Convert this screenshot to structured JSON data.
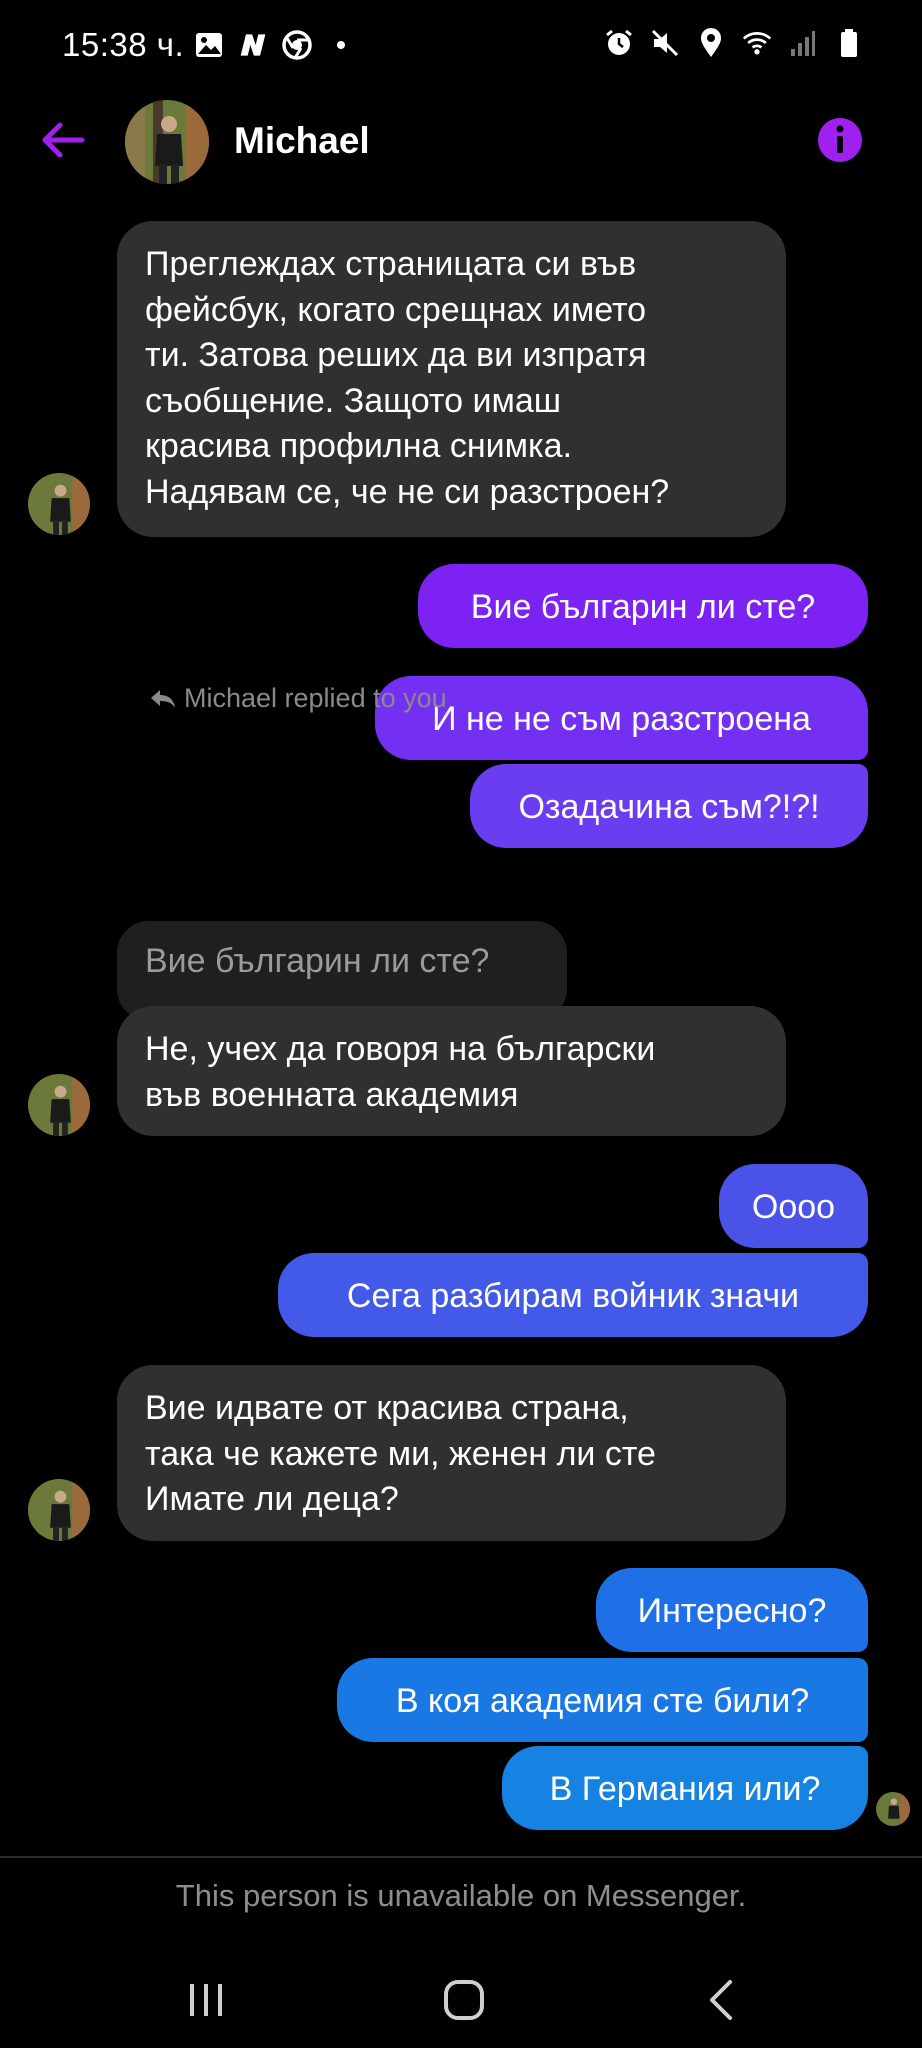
{
  "status_bar": {
    "time": "15:38 ч.",
    "left_icons": [
      "image-icon",
      "n-app-icon",
      "chrome-icon",
      "dot-icon"
    ],
    "right_icons": [
      "alarm-icon",
      "mute-icon",
      "location-icon",
      "wifi-icon",
      "signal-icon",
      "battery-icon"
    ]
  },
  "header": {
    "contact_name": "Michael"
  },
  "colors": {
    "accent_purple": "#a020f0",
    "incoming_bubble": "#303030",
    "outgoing_purple": "#7b22f5",
    "outgoing_indigo": "#4f55ea",
    "outgoing_blue": "#1a7be3"
  },
  "messages": [
    {
      "from": "Michael",
      "text": "Преглеждах страницата си във\nфейсбук, когато срещнах името\nти. Затова реших да ви изпратя\nсъобщение. Защото имаш\nкрасива профилна снимка.\nНадявам се, че не си разстроен?"
    },
    {
      "from": "me",
      "text": "Вие българин ли сте?"
    },
    {
      "from": "me",
      "text": "И не не съм разстроена"
    },
    {
      "from": "me",
      "text": "Озадачина съм?!?!"
    },
    {
      "from": "Michael",
      "reply_label": "Michael replied to you",
      "quoted": "Вие българин ли сте?",
      "text": "Не, учех да говоря на български\nвъв военната академия"
    },
    {
      "from": "me",
      "text": "Оооо"
    },
    {
      "from": "me",
      "text": "Сега разбирам войник значи"
    },
    {
      "from": "Michael",
      "text": "Вие идвате от красива страна,\nтака че кажете ми, женен ли сте\nИмате ли деца?"
    },
    {
      "from": "me",
      "text": "Интересно?"
    },
    {
      "from": "me",
      "text": "В коя академия сте били?"
    },
    {
      "from": "me",
      "text": "В Германия или?"
    }
  ],
  "footer": {
    "unavailable_text": "This person is unavailable on Messenger."
  },
  "nav": {
    "buttons": [
      "recent-apps-icon",
      "home-icon",
      "back-icon"
    ]
  }
}
